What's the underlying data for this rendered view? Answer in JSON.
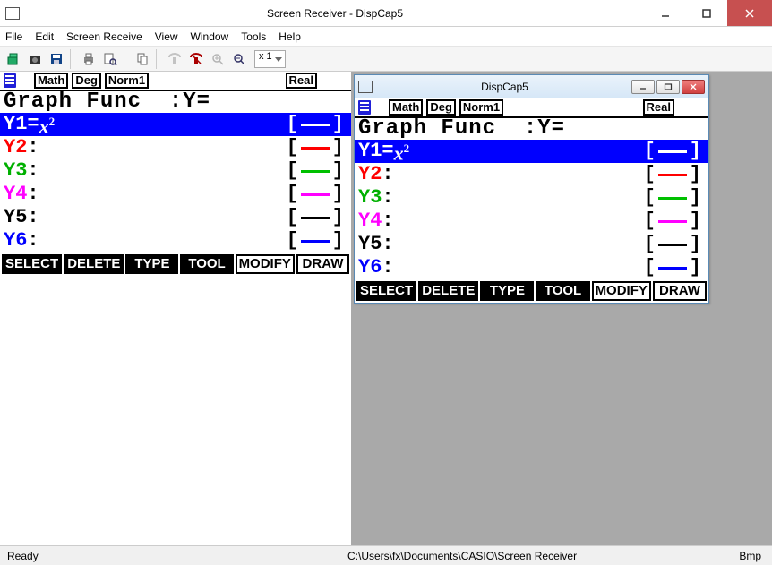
{
  "window": {
    "title": "Screen Receiver - DispCap5"
  },
  "menu": {
    "items": [
      "File",
      "Edit",
      "Screen Receive",
      "View",
      "Window",
      "Tools",
      "Help"
    ]
  },
  "toolbar": {
    "zoom": "x 1"
  },
  "calc": {
    "tags": {
      "math": "Math",
      "deg": "Deg",
      "norm": "Norm1",
      "real": "Real"
    },
    "headline_left": "Graph Func",
    "headline_right": ":Y=",
    "rows": [
      {
        "label": "Y1",
        "sep": "=",
        "expr_base": "x",
        "expr_sup": "2",
        "color": "blue",
        "selected": true
      },
      {
        "label": "Y2",
        "sep": ":",
        "expr_base": "",
        "expr_sup": "",
        "color": "red",
        "selected": false
      },
      {
        "label": "Y3",
        "sep": ":",
        "expr_base": "",
        "expr_sup": "",
        "color": "green",
        "selected": false
      },
      {
        "label": "Y4",
        "sep": ":",
        "expr_base": "",
        "expr_sup": "",
        "color": "magenta",
        "selected": false
      },
      {
        "label": "Y5",
        "sep": ":",
        "expr_base": "",
        "expr_sup": "",
        "color": "black",
        "selected": false
      },
      {
        "label": "Y6",
        "sep": ":",
        "expr_base": "",
        "expr_sup": "",
        "color": "blue",
        "selected": false
      }
    ],
    "softkeys": [
      {
        "text": "SELECT",
        "inv": true
      },
      {
        "text": "DELETE",
        "inv": true
      },
      {
        "text": "TYPE",
        "inv": true
      },
      {
        "text": "TOOL",
        "inv": true
      },
      {
        "text": "MODIFY",
        "inv": false
      },
      {
        "text": "DRAW",
        "inv": false
      }
    ]
  },
  "child": {
    "title": "DispCap5"
  },
  "status": {
    "ready": "Ready",
    "path": "C:\\Users\\fx\\Documents\\CASIO\\Screen Receiver",
    "format": "Bmp"
  }
}
